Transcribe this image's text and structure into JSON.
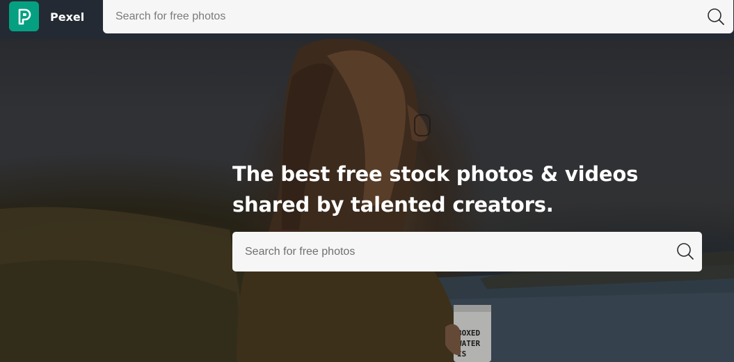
{
  "header": {
    "brand": "Pexel",
    "search": {
      "placeholder": "Search for free photos",
      "value": ""
    },
    "logo_color": "#05a081"
  },
  "hero": {
    "headline": "The best free stock photos & videos shared by talented creators.",
    "search": {
      "placeholder": "Search for free photos",
      "value": ""
    },
    "can_text": [
      "BOXED",
      "WATER",
      "IS"
    ]
  },
  "icons": {
    "logo": "pexels-p-logo",
    "search": "magnifier-icon"
  }
}
